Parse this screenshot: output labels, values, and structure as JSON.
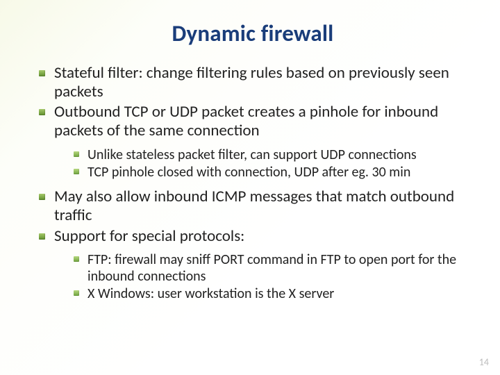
{
  "title": "Dynamic firewall",
  "items": [
    {
      "text": "Stateful filter: change filtering rules based on previously seen packets"
    },
    {
      "text": "Outbound TCP or UDP packet creates a pinhole for inbound packets of the same connection",
      "children": [
        {
          "text": "Unlike stateless packet filter, can support UDP connections"
        },
        {
          "text": "TCP pinhole closed with connection, UDP after eg. 30 min"
        }
      ]
    },
    {
      "text": "May also allow inbound ICMP messages that match outbound traffic"
    },
    {
      "text": "Support for special protocols:",
      "children": [
        {
          "text": "FTP: firewall may sniff PORT command in FTP to open port for the inbound connections"
        },
        {
          "text": "X Windows: user workstation is the X server"
        }
      ]
    }
  ],
  "page_number": "14"
}
